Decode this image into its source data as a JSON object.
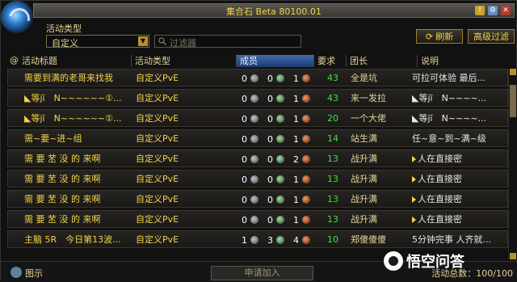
{
  "window": {
    "title": "集合石 Beta 80100.01"
  },
  "filter": {
    "label": "活动类型",
    "dropdown_value": "自定义",
    "search_placeholder": "过滤器"
  },
  "buttons": {
    "refresh": "刷新",
    "advanced": "高级过滤"
  },
  "columns": [
    "活动标题",
    "活动类型",
    "成员",
    "要求",
    "团长",
    "说明"
  ],
  "rows": [
    {
      "title": "需要到满的老哥来找我",
      "type": "自定义PvE",
      "tank": "0",
      "heal": "0",
      "dps": "1",
      "req": "43",
      "leader": "全是坑",
      "desc": "可拉可体验 最后..."
    },
    {
      "title": "◣等jī　N~~~~~~①...",
      "type": "自定义PvE",
      "tank": "0",
      "heal": "0",
      "dps": "1",
      "req": "43",
      "leader": "来一发拉",
      "desc": "◣等jī　N~~~~..."
    },
    {
      "title": "◣等jī　N~~~~~~①...",
      "type": "自定义PvE",
      "tank": "0",
      "heal": "0",
      "dps": "1",
      "req": "20",
      "leader": "一个大佬",
      "desc": "◣等jī　N~~~~..."
    },
    {
      "title": "需~要~进~组",
      "type": "自定义PvE",
      "tank": "0",
      "heal": "0",
      "dps": "1",
      "req": "14",
      "leader": "站生满",
      "desc": "任~意~到~满~级"
    },
    {
      "title": "需 要 苤 没 的 来啊",
      "type": "自定义PvE",
      "tank": "0",
      "heal": "0",
      "dps": "2",
      "req": "13",
      "leader": "战升满",
      "desc": "人在直接密"
    },
    {
      "title": "需 要 苤 没 的 来啊",
      "type": "自定义PvE",
      "tank": "0",
      "heal": "0",
      "dps": "1",
      "req": "13",
      "leader": "战升满",
      "desc": "人在直接密"
    },
    {
      "title": "需 要 苤 没 的 来啊",
      "type": "自定义PvE",
      "tank": "0",
      "heal": "0",
      "dps": "1",
      "req": "13",
      "leader": "战升满",
      "desc": "人在直接密"
    },
    {
      "title": "需 要 苤 没 的 来啊",
      "type": "自定义PvE",
      "tank": "0",
      "heal": "0",
      "dps": "1",
      "req": "13",
      "leader": "战升满",
      "desc": "人在直接密"
    },
    {
      "title": "主脑 5R　今日第13波...",
      "type": "自定义PvE",
      "tank": "1",
      "heal": "3",
      "dps": "4",
      "req": "10",
      "leader": "郑傻傻傻",
      "desc": "5分钟完事 人齐就..."
    }
  ],
  "footer": {
    "hint": "图示",
    "apply": "申请加入",
    "count": "活动总数：100/100"
  },
  "watermark": "悟空问答",
  "colors": {
    "accent_gold": "#f2d34a",
    "req_green": "#3fe23f",
    "header_active": "#3f6cae"
  }
}
